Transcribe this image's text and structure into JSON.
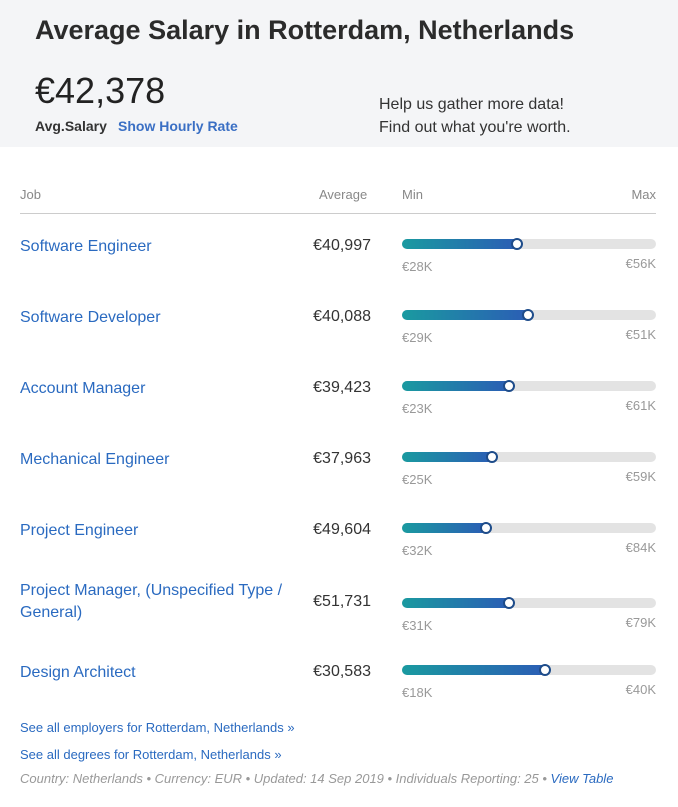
{
  "header": {
    "title": "Average Salary in Rotterdam, Netherlands",
    "amount": "€42,378",
    "avg_label": "Avg.Salary",
    "hourly_link": "Show Hourly Rate",
    "help_line1": "Help us gather more data!",
    "help_line2": "Find out what you're worth."
  },
  "columns": {
    "job": "Job",
    "average": "Average",
    "min": "Min",
    "max": "Max"
  },
  "rows": [
    {
      "job": "Software Engineer",
      "average": "€40,997",
      "min": "€28K",
      "max": "€56K",
      "fraction": 0.457
    },
    {
      "job": "Software Developer",
      "average": "€40,088",
      "min": "€29K",
      "max": "€51K",
      "fraction": 0.5
    },
    {
      "job": "Account Manager",
      "average": "€39,423",
      "min": "€23K",
      "max": "€61K",
      "fraction": 0.425
    },
    {
      "job": "Mechanical Engineer",
      "average": "€37,963",
      "min": "€25K",
      "max": "€59K",
      "fraction": 0.358
    },
    {
      "job": "Project Engineer",
      "average": "€49,604",
      "min": "€32K",
      "max": "€84K",
      "fraction": 0.335
    },
    {
      "job": "Project Manager, (Unspecified Type / General)",
      "average": "€51,731",
      "min": "€31K",
      "max": "€79K",
      "fraction": 0.425
    },
    {
      "job": "Design Architect",
      "average": "€30,583",
      "min": "€18K",
      "max": "€40K",
      "fraction": 0.567
    }
  ],
  "links": {
    "employers": "See all employers for Rotterdam, Netherlands »",
    "degrees": "See all degrees for Rotterdam, Netherlands »"
  },
  "footer": {
    "text": "Country: Netherlands • Currency: EUR • Updated: 14 Sep 2019 • Individuals Reporting: 25 • ",
    "view_table": "View Table"
  },
  "colors": {
    "accent": "#2a6ac0",
    "bar_start": "#1a9aa0",
    "bar_end": "#2b5db5"
  }
}
